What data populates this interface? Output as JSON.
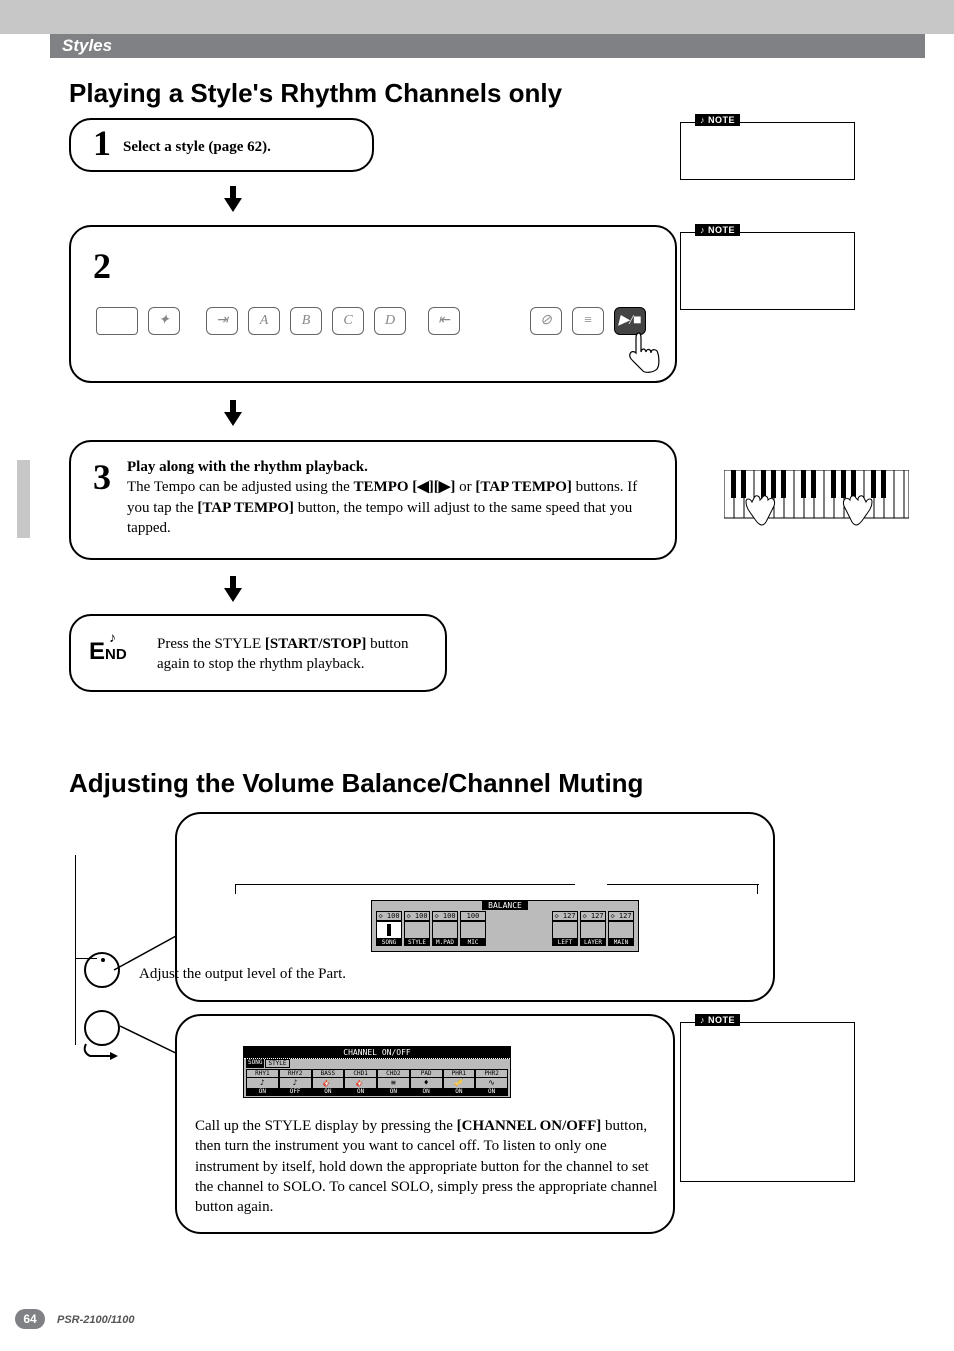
{
  "header": {
    "section_label": "Styles"
  },
  "title1": "Playing a Style's Rhythm Channels only",
  "step1": {
    "num": "1",
    "text": "Select a style (page 62)."
  },
  "step2": {
    "num": "2",
    "panel_letters": [
      "A",
      "B",
      "C",
      "D"
    ]
  },
  "step3": {
    "num": "3",
    "lead": "Play along with the rhythm playback.",
    "body_before": "The Tempo can be adjusted using the ",
    "tempo_bold": "TEMPO [◀][▶]",
    "body_mid": " or ",
    "tap_bold": "[TAP TEMPO]",
    "body_after": " buttons. If you tap the ",
    "tap_bold2": "[TAP TEMPO]",
    "body_end": " button, the tempo will adjust to the same speed that you tapped."
  },
  "end_step": {
    "label": "END",
    "text_before": "Press the STYLE ",
    "bold": "[START/STOP]",
    "text_after": " button again to stop the rhythm playback."
  },
  "title2": "Adjusting the Volume Balance/Channel Muting",
  "balance_panel": {
    "caption": "Adjust the output level of the Part.",
    "lcd_title": "BALANCE",
    "values_left": [
      "100",
      "100",
      "100",
      "100"
    ],
    "values_right": [
      "127",
      "127",
      "127"
    ],
    "labels_left": [
      "SONG",
      "STYLE",
      "M.PAD",
      "MIC"
    ],
    "labels_right": [
      "LEFT",
      "LAYER",
      "MAIN"
    ]
  },
  "channel_panel": {
    "lcd_title": "CHANNEL ON/OFF",
    "tabs": [
      "SONG",
      "STYLE"
    ],
    "cols": [
      "RHY1",
      "RHY2",
      "BASS",
      "CHD1",
      "CHD2",
      "PAD",
      "PHR1",
      "PHR2"
    ],
    "states": [
      "ON",
      "OFF",
      "ON",
      "ON",
      "ON",
      "ON",
      "ON",
      "ON"
    ],
    "text_before": "Call up the STYLE display by pressing the ",
    "bold": "[CHANNEL ON/OFF]",
    "text_after": " button, then turn the instrument you want to cancel off. To listen to only one instrument by itself, hold down the appropriate button for the channel to set the channel to SOLO. To cancel SOLO, simply press the appropriate channel button again."
  },
  "notes": {
    "label": "NOTE"
  },
  "footer": {
    "page": "64",
    "model": "PSR-2100/1100"
  }
}
